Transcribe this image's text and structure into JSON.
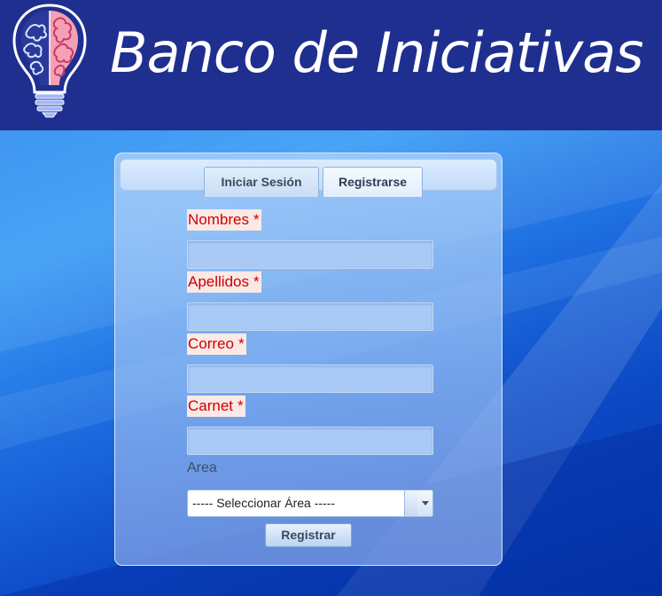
{
  "header": {
    "title": "Banco de Iniciativas",
    "background_color": "#1f2f8f",
    "logo_icon": "lightbulb-brain-icon"
  },
  "tabs": [
    {
      "label": "Iniciar Sesión",
      "active": false
    },
    {
      "label": "Registrarse",
      "active": true
    }
  ],
  "form": {
    "fields": [
      {
        "label": "Nombres",
        "required_mark": "*",
        "value": ""
      },
      {
        "label": "Apellidos",
        "required_mark": "*",
        "value": ""
      },
      {
        "label": "Correo",
        "required_mark": "*",
        "value": ""
      },
      {
        "label": "Carnet",
        "required_mark": "*",
        "value": ""
      }
    ],
    "area": {
      "label": "Area",
      "selected": "----- Seleccionar Área -----"
    },
    "submit_label": "Registrar"
  },
  "colors": {
    "required_label_text": "#cc0000",
    "required_label_background": "#fbe9e6"
  }
}
